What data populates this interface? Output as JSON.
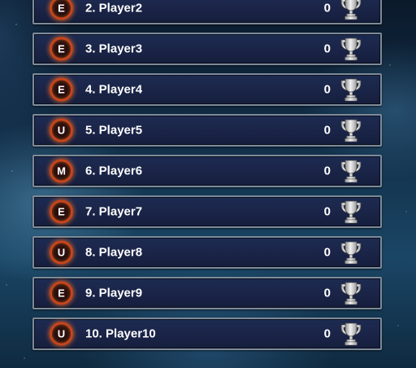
{
  "leaderboard": {
    "rows": [
      {
        "badge": "E",
        "name": "2. Player2",
        "score": "0"
      },
      {
        "badge": "E",
        "name": "3. Player3",
        "score": "0"
      },
      {
        "badge": "E",
        "name": "4. Player4",
        "score": "0"
      },
      {
        "badge": "U",
        "name": "5. Player5",
        "score": "0"
      },
      {
        "badge": "M",
        "name": "6. Player6",
        "score": "0"
      },
      {
        "badge": "E",
        "name": "7. Player7",
        "score": "0"
      },
      {
        "badge": "U",
        "name": "8. Player8",
        "score": "0"
      },
      {
        "badge": "E",
        "name": "9. Player9",
        "score": "0"
      },
      {
        "badge": "U",
        "name": "10. Player10",
        "score": "0"
      }
    ]
  },
  "icons": {
    "badge": "rank-badge-icon",
    "trophy": "trophy-icon"
  },
  "colors": {
    "badge_ring": "#c7451b",
    "row_background": "#1d2b52",
    "row_border": "#7d8a99",
    "trophy_silver": "#c9c9c9"
  }
}
